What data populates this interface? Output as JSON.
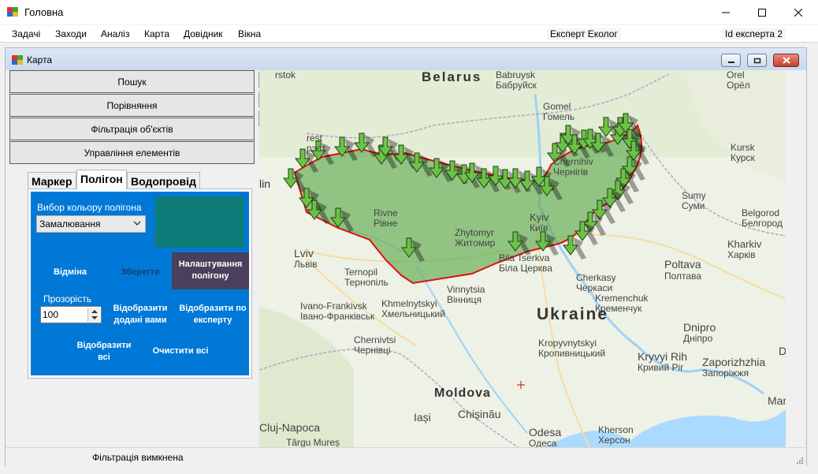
{
  "window": {
    "title": "Головна",
    "controls": [
      "minimize-icon",
      "maximize-icon",
      "close-icon"
    ]
  },
  "menu": {
    "items": [
      "Задачі",
      "Заходи",
      "Аналіз",
      "Карта",
      "Довідник",
      "Вікна"
    ],
    "role_label": "Експерт Еколог",
    "expert_id_label": "Id експерта 2"
  },
  "child_window": {
    "title": "Карта"
  },
  "nav_buttons": [
    "Пошук",
    "Порівняння",
    "Фільтрація об'єктів",
    "Управління елементів"
  ],
  "tabs": {
    "items": [
      "Маркер",
      "Полігон",
      "Водопровід"
    ],
    "active": "Полігон"
  },
  "polygon_panel": {
    "color_label": "Вибор кольору полігона",
    "fill_select_value": "Замалювання",
    "color_preview": "#0e7d7a",
    "cancel_label": "Відміна",
    "save_label": "Зберегти",
    "settings_label": "Налаштування полігону",
    "opacity_label": "Прозорість",
    "opacity_value": "100",
    "show_added_label": "Відобразити додані вами",
    "show_expert_label": "Відобразити по експерту",
    "show_all_label": "Відобразити всі",
    "clear_all_label": "Очистити всі",
    "panel_color": "#0078d7"
  },
  "zoom": {
    "minimize": "_",
    "zoom_in": "+",
    "zoom_out": "-"
  },
  "map": {
    "labels": {
      "belarus": "Belarus",
      "ukraine": "Ukraine",
      "moldova": "Moldova",
      "babruysk": "Babruysk",
      "babruysk_local": "Бабруйск",
      "gomel": "Gomel",
      "gomel_local": "Гомель",
      "orel": "Orel",
      "orel_local": "Орёл",
      "kursk": "Kursk",
      "kursk_local": "Курск",
      "sumy": "Sumy",
      "sumy_local": "Суми",
      "belgorod": "Belgorod",
      "belgorod_local": "Белгород",
      "kharkiv": "Kharkiv",
      "kharkiv_local": "Харків",
      "chernihiv": "Chernihiv",
      "chernihiv_local": "Чернігів",
      "kyiv": "Kyiv",
      "kyiv_local": "Київ",
      "zhytomyr": "Zhytomyr",
      "zhytomyr_local": "Житомир",
      "rivne": "Rivne",
      "rivne_local": "Рівне",
      "bila_tserkva": "Bila Tserkva",
      "bila_tserkva_local": "Біла Церква",
      "poltava": "Poltava",
      "poltava_local": "Полтава",
      "cherkasy": "Cherkasy",
      "cherkasy_local": "Черкаси",
      "kremenchuk": "Kremenchuk",
      "kremenchuk_local": "Кременчук",
      "lviv": "Lviv",
      "lviv_local": "Львів",
      "ternopil": "Ternopil",
      "ternopil_local": "Тернопіль",
      "vinnytsia": "Vinnytsia",
      "vinnytsia_local": "Вінниця",
      "khmelnytskyi": "Khmelnytskyi",
      "khmelnytskyi_local": "Хмельницький",
      "ivano": "Ivano-Frankivsk",
      "ivano_local": "Івано-Франківськ",
      "chernivtsi": "Chernivtsi",
      "chernivtsi_local": "Чернівці",
      "kropyvnytskyi": "Kropyvnytskyi",
      "kropyvnytskyi_local": "Кропивницький",
      "dnipro": "Dnipro",
      "dnipro_local": "Дніпро",
      "kryvyi": "Kryvyi Rih",
      "kryvyi_local": "Кривий Ріг",
      "zaporizhzhia": "Zaporizhzhia",
      "zaporizhzhia_local": "Запоріжжя",
      "iasi": "Iași",
      "chisinau": "Chișinău",
      "cluj": "Cluj-Napoca",
      "targu": "Târgu Mureș",
      "odesa": "Odesa",
      "odesa_local": "Одеса",
      "kherson": "Kherson",
      "kherson_local": "Херсон",
      "brest_partial": "rest",
      "brest_partial_local": "рэст",
      "pinsk_partial": "lin",
      "mar_partial": "Mar",
      "d_partial": "D",
      "rstok_partial": "rstok"
    },
    "polygon_fill": "#5faa4e",
    "polygon_stroke": "#e01010",
    "marker_color": "#6cc247",
    "marker_count": 47
  },
  "status": {
    "text": "Фільтрація вимкнена"
  }
}
